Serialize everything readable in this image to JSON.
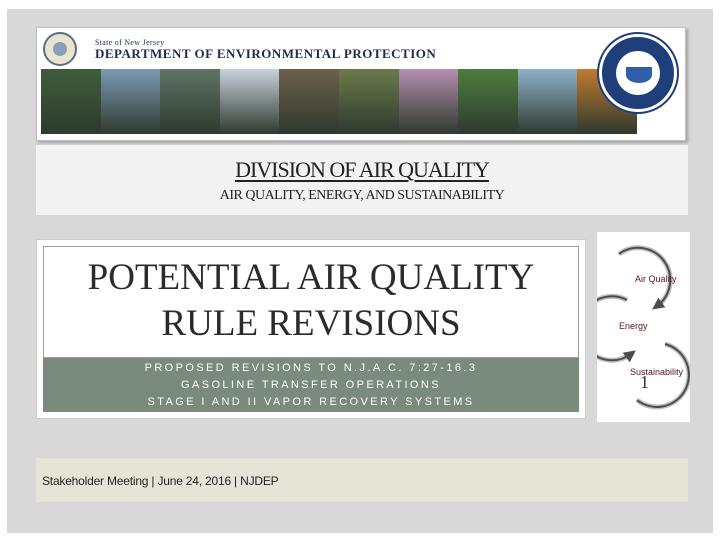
{
  "header": {
    "state_line": "State of New Jersey",
    "department": "Department of Environmental Protection",
    "photos": [
      "#3f5d3a",
      "#7c9ab5",
      "#5f7466",
      "#c9d2dc",
      "#6f5f4b",
      "#6b7a4a",
      "#b48fb0",
      "#4e7d3e",
      "#8fb2c9",
      "#c07a30"
    ]
  },
  "division": {
    "title": "DIVISION OF AIR QUALITY",
    "subtitle": "AIR QUALITY, ENERGY, AND SUSTAINABILITY"
  },
  "main": {
    "title_line1": "POTENTIAL AIR QUALITY",
    "title_line2": "RULE REVISIONS",
    "subtitle_lines": [
      "PROPOSED REVISIONS TO N.J.A.C. 7:27-16.3",
      "GASOLINE TRANSFER OPERATIONS",
      "STAGE I AND II VAPOR RECOVERY SYSTEMS"
    ]
  },
  "cycle": {
    "items": [
      "Air Quality",
      "Energy",
      "Sustainability"
    ],
    "page_number": "1"
  },
  "footer": {
    "text": "Stakeholder Meeting | June 24, 2016 | NJDEP"
  },
  "colors": {
    "background": "#d8d8d8",
    "band": "#7a8a7c",
    "footer": "#e6e4d6",
    "arrow_dark": "#4d4d4d",
    "arrow_light": "#bfbfbf"
  }
}
